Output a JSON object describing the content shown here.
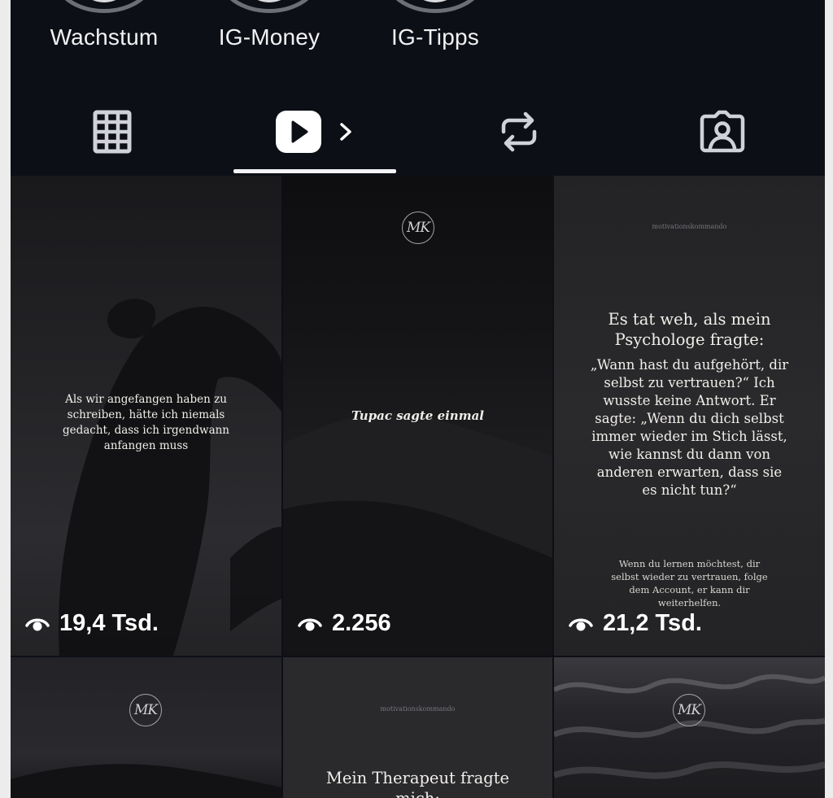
{
  "highlights": [
    {
      "label": "Wachstum"
    },
    {
      "label": "IG-Money"
    },
    {
      "label": "IG-Tipps"
    }
  ],
  "tabs": [
    {
      "icon": "grid-icon",
      "active": false
    },
    {
      "icon": "reels-icon",
      "active": true
    },
    {
      "icon": "reposts-icon",
      "active": false
    },
    {
      "icon": "tagged-icon",
      "active": false
    }
  ],
  "reels": [
    {
      "text": "Als wir angefangen haben zu schreiben, hätte ich niemals gedacht, dass ich irgendwann anfangen muss",
      "views": "19,4 Tsd."
    },
    {
      "logo": "MK",
      "text": "Tupac sagte einmal",
      "views": "2.256"
    },
    {
      "brand": "motivationskommando",
      "title": "Es tat weh, als mein Psychologe fragte:",
      "body": "„Wann hast du aufgehört, dir selbst zu vertrauen?“ Ich wusste keine Antwort. Er sagte: „Wenn du dich selbst immer wieder im Stich lässt, wie kannst du dann von anderen erwarten, dass sie es nicht tun?“",
      "footer": "Wenn du lernen möchtest, dir selbst wieder zu vertrauen, folge dem Account, er kann dir weiterhelfen.",
      "views": "21,2 Tsd."
    },
    {
      "logo": "MK"
    },
    {
      "brand": "motivationskommando",
      "title": "Mein Therapeut fragte mich:"
    },
    {
      "logo": "MK"
    }
  ],
  "colors": {
    "background": "#0d0f16",
    "tab_indicator": "#f4f4f6",
    "icon": "#d0d2d8"
  }
}
